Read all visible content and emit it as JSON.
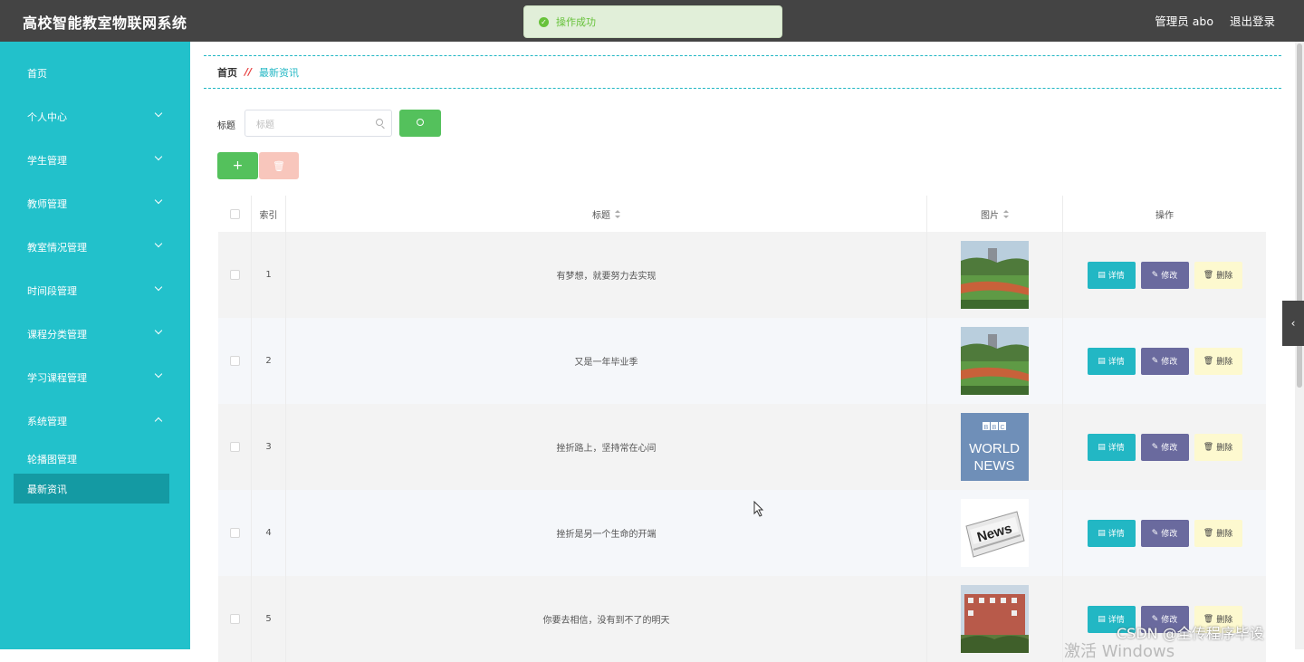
{
  "header": {
    "app_title": "高校智能教室物联网系统",
    "user_label": "管理员 abo",
    "logout_label": "退出登录"
  },
  "toast": {
    "message": "操作成功"
  },
  "sidebar": {
    "items": [
      {
        "label": "首页",
        "expandable": false
      },
      {
        "label": "个人中心",
        "expandable": true
      },
      {
        "label": "学生管理",
        "expandable": true
      },
      {
        "label": "教师管理",
        "expandable": true
      },
      {
        "label": "教室情况管理",
        "expandable": true
      },
      {
        "label": "时间段管理",
        "expandable": true
      },
      {
        "label": "课程分类管理",
        "expandable": true
      },
      {
        "label": "学习课程管理",
        "expandable": true
      },
      {
        "label": "系统管理",
        "expandable": true
      }
    ],
    "sub_items": [
      {
        "label": "轮播图管理",
        "active": false
      },
      {
        "label": "最新资讯",
        "active": true
      }
    ]
  },
  "breadcrumb": {
    "home": "首页",
    "separator": "//",
    "current": "最新资讯"
  },
  "search": {
    "label": "标题",
    "placeholder": "标题"
  },
  "actions": {
    "add": "+",
    "delete_icon": "trash-icon"
  },
  "table": {
    "headers": {
      "index": "索引",
      "title": "标题",
      "image": "图片",
      "ops": "操作"
    },
    "op_labels": {
      "detail": "详情",
      "edit": "修改",
      "delete": "删除"
    },
    "rows": [
      {
        "index": "1",
        "title": "有梦想，就要努力去实现",
        "image": "campus-track"
      },
      {
        "index": "2",
        "title": "又是一年毕业季",
        "image": "campus-track"
      },
      {
        "index": "3",
        "title": "挫折路上，坚持常在心间",
        "image": "bbc-world-news"
      },
      {
        "index": "4",
        "title": "挫折是另一个生命的开端",
        "image": "news-paper"
      },
      {
        "index": "5",
        "title": "你要去相信，没有到不了的明天",
        "image": "campus-building"
      }
    ]
  },
  "thumb_text": {
    "bbc": "BBC",
    "world": "WORLD",
    "news": "NEWS",
    "paper": "News"
  },
  "watermark": "CSDN @全传程序毕设",
  "watermark2": "激活 Windows",
  "colors": {
    "sidebar": "#22c1cb",
    "topbar": "#444444",
    "accent": "#22b7c4",
    "success": "#54c15c"
  }
}
